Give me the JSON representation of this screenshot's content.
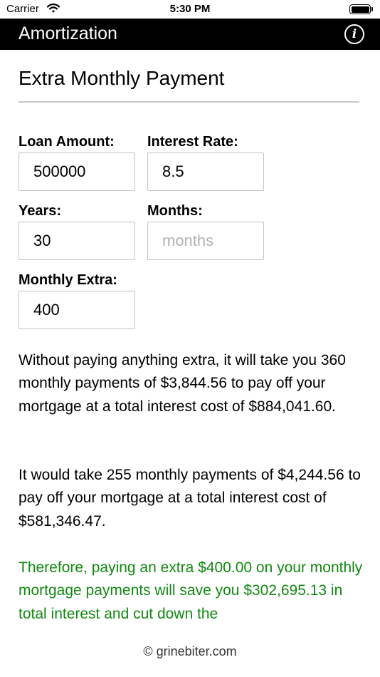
{
  "status_bar": {
    "carrier": "Carrier",
    "time": "5:30 PM"
  },
  "nav": {
    "title": "Amortization",
    "info_icon_glyph": "i"
  },
  "section": {
    "title": "Extra Monthly Payment"
  },
  "fields": {
    "loan_amount": {
      "label": "Loan Amount:",
      "value": "500000",
      "placeholder": ""
    },
    "interest_rate": {
      "label": "Interest Rate:",
      "value": "8.5",
      "placeholder": ""
    },
    "years": {
      "label": "Years:",
      "value": "30",
      "placeholder": ""
    },
    "months": {
      "label": "Months:",
      "value": "",
      "placeholder": "months"
    },
    "monthly_extra": {
      "label": "Monthly Extra:",
      "value": "400",
      "placeholder": ""
    }
  },
  "results": {
    "without_extra": "Without paying anything extra, it will take you 360 monthly payments of $3,844.56 to pay off your mortgage at a total interest cost of $884,041.60.",
    "with_extra": "It would take 255 monthly payments of $4,244.56 to pay off your mortgage at a total interest cost of $581,346.47.",
    "savings": "Therefore, paying an extra $400.00 on your monthly mortgage payments will save you $302,695.13 in total interest and cut down the"
  },
  "footer": {
    "text": "© grinebiter.com"
  },
  "colors": {
    "nav_background": "#000000",
    "savings_text": "#108a10",
    "input_border": "#c2c2c2"
  }
}
